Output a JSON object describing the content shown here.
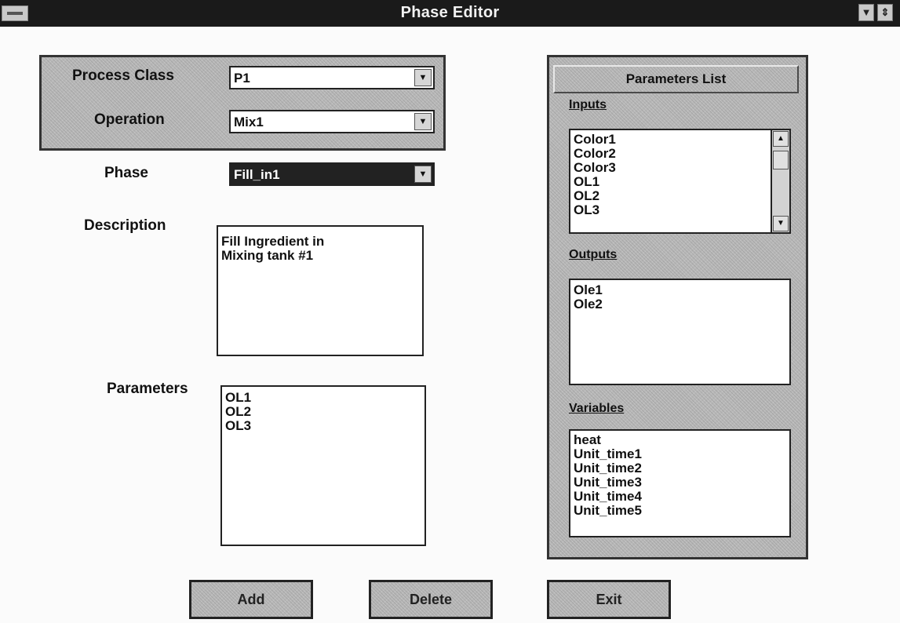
{
  "window": {
    "title": "Phase Editor"
  },
  "form": {
    "process_class": {
      "label": "Process Class",
      "value": "P1"
    },
    "operation": {
      "label": "Operation",
      "value": "Mix1"
    },
    "phase": {
      "label": "Phase",
      "value": "Fill_in1"
    },
    "description": {
      "label": "Description",
      "lines": [
        "Fill Ingredient in",
        "Mixing tank #1"
      ]
    },
    "parameters": {
      "label": "Parameters",
      "items": [
        "OL1",
        "OL2",
        "OL3"
      ]
    }
  },
  "parameters_list": {
    "title": "Parameters List",
    "inputs": {
      "label": "Inputs",
      "items": [
        "Color1",
        "Color2",
        "Color3",
        "OL1",
        "OL2",
        "OL3"
      ]
    },
    "outputs": {
      "label": "Outputs",
      "items": [
        "Ole1",
        "Ole2"
      ]
    },
    "variables": {
      "label": "Variables",
      "items": [
        "heat",
        "Unit_time1",
        "Unit_time2",
        "Unit_time3",
        "Unit_time4",
        "Unit_time5"
      ]
    }
  },
  "buttons": {
    "add": "Add",
    "delete": "Delete",
    "exit": "Exit"
  },
  "icons": {
    "system_menu": "system-menu-icon",
    "minimize": "minimize-icon",
    "maximize": "maximize-icon",
    "dropdown": "dropdown-arrow-icon",
    "scroll_up": "scroll-up-icon",
    "scroll_down": "scroll-down-icon"
  },
  "colors": {
    "titlebar": "#1a1a1a",
    "panel": "#b9b9b9",
    "selected": "#222222"
  }
}
